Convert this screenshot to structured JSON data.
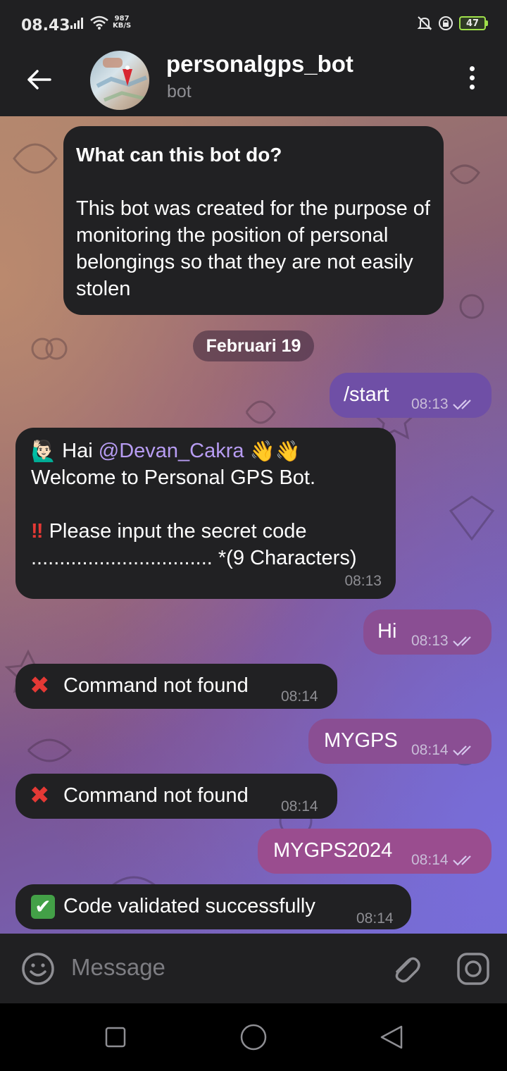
{
  "status": {
    "time": "08.43",
    "speed_value": "987",
    "speed_unit": "KB/S",
    "battery": "47"
  },
  "header": {
    "title": "personalgps_bot",
    "subtitle": "bot"
  },
  "info_card": {
    "title": "What can this bot do?",
    "text": "This bot was created for the purpose of monitoring the position of personal belongings so that they are not easily stolen"
  },
  "date_label": "Februari 19",
  "messages": {
    "m1": {
      "text": "/start",
      "time": "08:13"
    },
    "m2": {
      "line1_prefix": "Hai ",
      "mention": "@Devan_Cakra",
      "line2": "Welcome to Personal GPS Bot.",
      "line3": "Please input the secret code",
      "line4": "................................ *(9 Characters)",
      "time": "08:13"
    },
    "m3": {
      "text": "Hi",
      "time": "08:13"
    },
    "m4": {
      "text": "Command not found",
      "time": "08:14"
    },
    "m5": {
      "text": "MYGPS",
      "time": "08:14"
    },
    "m6": {
      "text": "Command not found",
      "time": "08:14"
    },
    "m7": {
      "text": "MYGPS2024",
      "time": "08:14"
    },
    "m8": {
      "text": "Code validated successfully",
      "time": "08:14"
    }
  },
  "input": {
    "placeholder": "Message"
  },
  "colors": {
    "header_bg": "#202022",
    "incoming_bubble": "#212123",
    "outgoing_bubble": "#7a4696",
    "mention": "#b79cf2",
    "error_red": "#e53935",
    "success_green": "#43a047"
  },
  "icons": [
    "back-arrow-icon",
    "more-vert-icon",
    "emoji-icon",
    "attach-icon",
    "camera-icon",
    "double-check-icon",
    "cross-mark-icon",
    "check-mark-icon",
    "double-exclamation-icon",
    "wave-icon",
    "raised-hand-icon"
  ]
}
